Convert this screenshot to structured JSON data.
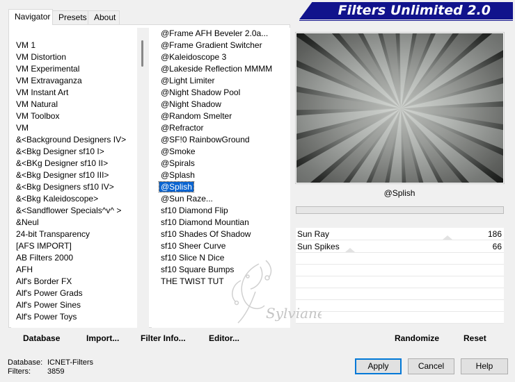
{
  "app": {
    "title": "Filters Unlimited 2.0"
  },
  "tabs": [
    {
      "label": "Navigator",
      "active": true
    },
    {
      "label": "Presets",
      "active": false
    },
    {
      "label": "About",
      "active": false
    }
  ],
  "categories": [
    "VM 1",
    "VM Distortion",
    "VM Experimental",
    "VM Extravaganza",
    "VM Instant Art",
    "VM Natural",
    "VM Toolbox",
    "VM",
    "&<Background Designers IV>",
    "&<Bkg Designer sf10 I>",
    "&<BKg Designer sf10 II>",
    "&<Bkg Designer sf10 III>",
    "&<Bkg Designers sf10 IV>",
    "&<Bkg Kaleidoscope>",
    "&<Sandflower Specials^v^ >",
    "&Neul",
    "24-bit Transparency",
    "[AFS IMPORT]",
    "AB Filters 2000",
    "AFH",
    "Alf's Border FX",
    "Alf's Power Grads",
    "Alf's Power Sines",
    "Alf's Power Toys"
  ],
  "filters": [
    "@Frame AFH Beveler 2.0a...",
    "@Frame Gradient Switcher",
    "@Kaleidoscope 3",
    "@Lakeside Reflection MMMM",
    "@Light Limiter",
    "@Night Shadow Pool",
    "@Night Shadow",
    "@Random Smelter",
    "@Refractor",
    "@SF!0 RainbowGround",
    "@Smoke",
    "@Spirals",
    "@Splash",
    "@Splish",
    "@Sun Raze...",
    "sf10 Diamond Flip",
    "sf10 Diamond Mountian",
    "sf10 Shades Of Shadow",
    "sf10 Sheer Curve",
    "sf10 Slice N Dice",
    "sf10 Square Bumps",
    "THE TWIST TUT"
  ],
  "selected_filter": "@Splish",
  "params": [
    {
      "label": "Sun Ray",
      "value": "186",
      "level": 0.73
    },
    {
      "label": "Sun Spikes",
      "value": "66",
      "level": 0.26
    }
  ],
  "toolbar": {
    "database": "Database",
    "import": "Import...",
    "filter_info": "Filter Info...",
    "editor": "Editor...",
    "randomize": "Randomize",
    "reset": "Reset"
  },
  "status": {
    "database_label": "Database:",
    "database_value": "ICNET-Filters",
    "filters_label": "Filters:",
    "filters_value": "3859"
  },
  "buttons": {
    "apply": "Apply",
    "cancel": "Cancel",
    "help": "Help"
  },
  "watermark": {
    "text": "Sylviane"
  },
  "colors": {
    "banner": "#11138c",
    "selection": "#0a64d0"
  }
}
